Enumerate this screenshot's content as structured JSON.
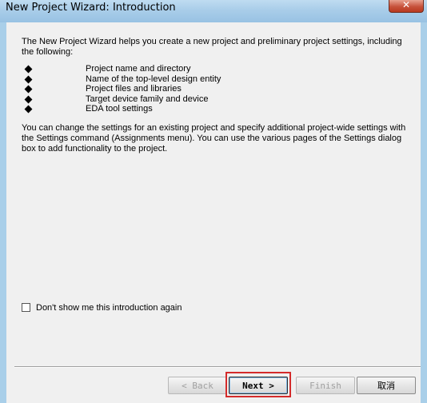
{
  "window": {
    "title": "New Project Wizard: Introduction",
    "close_symbol": "✕"
  },
  "content": {
    "intro": "The New Project Wizard helps you create a new project and preliminary project settings, including the following:",
    "features": [
      "Project name and directory",
      "Name of the top-level design entity",
      "Project files and libraries",
      "Target device family and device",
      "EDA tool settings"
    ],
    "settings_note": "You can change the settings for an existing project and specify additional project-wide settings with the Settings command (Assignments menu). You can use the various pages of the Settings dialog box to add functionality to the project."
  },
  "options": {
    "dont_show_label": "Don't show me this introduction again",
    "dont_show_checked": false
  },
  "buttons": {
    "back": "< Back",
    "next": "Next >",
    "finish": "Finish",
    "cancel": "取消"
  },
  "colors": {
    "highlight_border": "#d42b2b",
    "title_bar": "#a9cde9"
  }
}
